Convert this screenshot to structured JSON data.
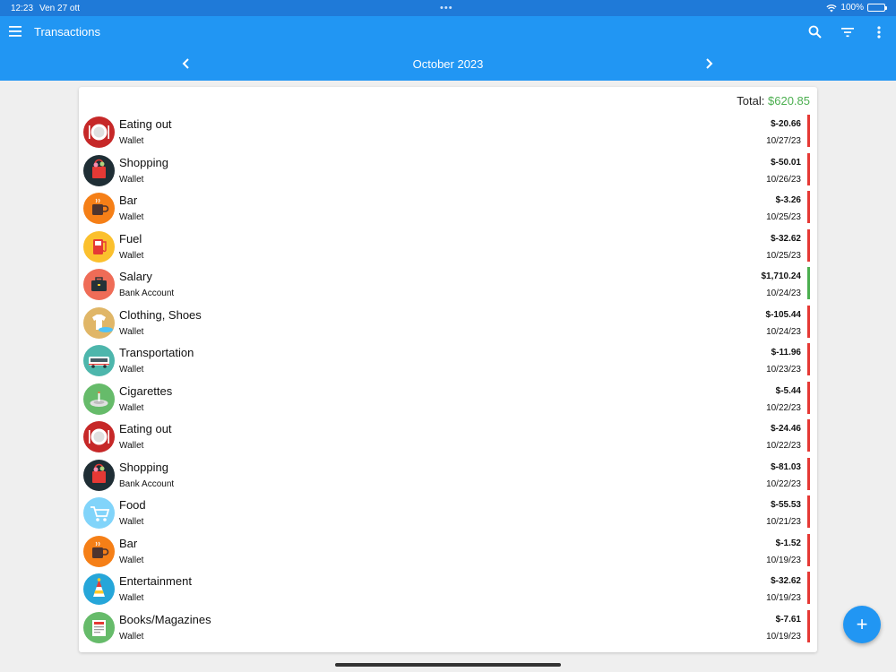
{
  "status": {
    "time": "12:23",
    "date": "Ven 27 ott",
    "battery": "100%"
  },
  "appbar": {
    "title": "Transactions",
    "month": "October 2023"
  },
  "summary": {
    "total_label": "Total:",
    "total_value": "$620.85"
  },
  "colors": {
    "accent": "#2196f3",
    "expense": "#e53935",
    "income": "#4caf50"
  },
  "transactions": [
    {
      "category": "Eating out",
      "account": "Wallet",
      "amount": "$-20.66",
      "date": "10/27/23",
      "type": "expense",
      "icon": "plate-icon",
      "icon_color": "#c62828"
    },
    {
      "category": "Shopping",
      "account": "Wallet",
      "amount": "$-50.01",
      "date": "10/26/23",
      "type": "expense",
      "icon": "shopping-bag-icon",
      "icon_color": "#1f2e35"
    },
    {
      "category": "Bar",
      "account": "Wallet",
      "amount": "$-3.26",
      "date": "10/25/23",
      "type": "expense",
      "icon": "mug-icon",
      "icon_color": "#f57f17"
    },
    {
      "category": "Fuel",
      "account": "Wallet",
      "amount": "$-32.62",
      "date": "10/25/23",
      "type": "expense",
      "icon": "fuel-pump-icon",
      "icon_color": "#fbc02d"
    },
    {
      "category": "Salary",
      "account": "Bank Account",
      "amount": "$1,710.24",
      "date": "10/24/23",
      "type": "income",
      "icon": "briefcase-icon",
      "icon_color": "#ef6c57"
    },
    {
      "category": "Clothing, Shoes",
      "account": "Wallet",
      "amount": "$-105.44",
      "date": "10/24/23",
      "type": "expense",
      "icon": "tshirt-icon",
      "icon_color": "#e0b667"
    },
    {
      "category": "Transportation",
      "account": "Wallet",
      "amount": "$-11.96",
      "date": "10/23/23",
      "type": "expense",
      "icon": "bus-icon",
      "icon_color": "#4db6ac"
    },
    {
      "category": "Cigarettes",
      "account": "Wallet",
      "amount": "$-5.44",
      "date": "10/22/23",
      "type": "expense",
      "icon": "ashtray-icon",
      "icon_color": "#66bb6a"
    },
    {
      "category": "Eating out",
      "account": "Wallet",
      "amount": "$-24.46",
      "date": "10/22/23",
      "type": "expense",
      "icon": "plate-icon",
      "icon_color": "#c62828"
    },
    {
      "category": "Shopping",
      "account": "Bank Account",
      "amount": "$-81.03",
      "date": "10/22/23",
      "type": "expense",
      "icon": "shopping-bag-icon",
      "icon_color": "#1f2e35"
    },
    {
      "category": "Food",
      "account": "Wallet",
      "amount": "$-55.53",
      "date": "10/21/23",
      "type": "expense",
      "icon": "cart-icon",
      "icon_color": "#81d4fa"
    },
    {
      "category": "Bar",
      "account": "Wallet",
      "amount": "$-1.52",
      "date": "10/19/23",
      "type": "expense",
      "icon": "mug-icon",
      "icon_color": "#f57f17"
    },
    {
      "category": "Entertainment",
      "account": "Wallet",
      "amount": "$-32.62",
      "date": "10/19/23",
      "type": "expense",
      "icon": "party-hat-icon",
      "icon_color": "#26a6d9"
    },
    {
      "category": "Books/Magazines",
      "account": "Wallet",
      "amount": "$-7.61",
      "date": "10/19/23",
      "type": "expense",
      "icon": "newspaper-icon",
      "icon_color": "#66bb6a"
    }
  ]
}
